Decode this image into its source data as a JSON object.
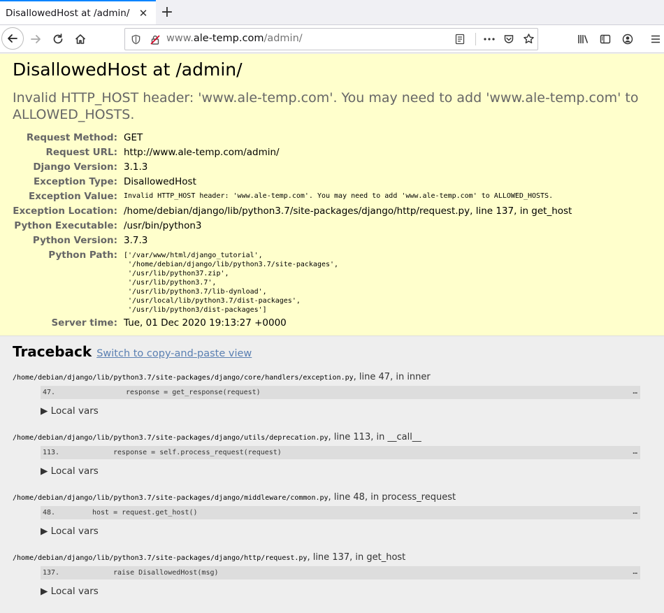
{
  "browser": {
    "tab_title": "DisallowedHost at /admin/",
    "url_prefix": "www.",
    "url_domain": "ale-temp.com",
    "url_path": "/admin/"
  },
  "summary": {
    "title": "DisallowedHost at /admin/",
    "message": "Invalid HTTP_HOST header: 'www.ale-temp.com'. You may need to add 'www.ale-temp.com' to ALLOWED_HOSTS.",
    "rows": [
      {
        "label": "Request Method:",
        "value": "GET"
      },
      {
        "label": "Request URL:",
        "value": "http://www.ale-temp.com/admin/"
      },
      {
        "label": "Django Version:",
        "value": "3.1.3"
      },
      {
        "label": "Exception Type:",
        "value": "DisallowedHost"
      },
      {
        "label": "Exception Value:",
        "value": "Invalid HTTP_HOST header: 'www.ale-temp.com'. You may need to add 'www.ale-temp.com' to ALLOWED_HOSTS."
      },
      {
        "label": "Exception Location:",
        "value": "/home/debian/django/lib/python3.7/site-packages/django/http/request.py, line 137, in get_host"
      },
      {
        "label": "Python Executable:",
        "value": "/usr/bin/python3"
      },
      {
        "label": "Python Version:",
        "value": "3.7.3"
      },
      {
        "label": "Python Path:",
        "value": "['/var/www/html/django_tutorial',\n '/home/debian/django/lib/python3.7/site-packages',\n '/usr/lib/python37.zip',\n '/usr/lib/python3.7',\n '/usr/lib/python3.7/lib-dynload',\n '/usr/local/lib/python3.7/dist-packages',\n '/usr/lib/python3/dist-packages']"
      },
      {
        "label": "Server time:",
        "value": "Tue, 01 Dec 2020 19:13:27 +0000"
      }
    ]
  },
  "traceback": {
    "title": "Traceback",
    "switch_link": "Switch to copy-and-paste view",
    "frames": [
      {
        "path": "/home/debian/django/lib/python3.7/site-packages/django/core/handlers/exception.py",
        "where": ", line 47, in inner",
        "lineno": "47.",
        "code": "response = get_response(request)",
        "local_vars": "▶ Local vars",
        "dash": "…"
      },
      {
        "path": "/home/debian/django/lib/python3.7/site-packages/django/utils/deprecation.py",
        "where": ", line 113, in __call__",
        "lineno": "113.",
        "code": "response = self.process_request(request)",
        "local_vars": "▶ Local vars",
        "dash": "…"
      },
      {
        "path": "/home/debian/django/lib/python3.7/site-packages/django/middleware/common.py",
        "where": ", line 48, in process_request",
        "lineno": "48.",
        "code": "host = request.get_host()",
        "local_vars": "▶ Local vars",
        "dash": "…"
      },
      {
        "path": "/home/debian/django/lib/python3.7/site-packages/django/http/request.py",
        "where": ", line 137, in get_host",
        "lineno": "137.",
        "code": "raise DisallowedHost(msg)",
        "local_vars": "▶ Local vars",
        "dash": "…"
      }
    ]
  }
}
